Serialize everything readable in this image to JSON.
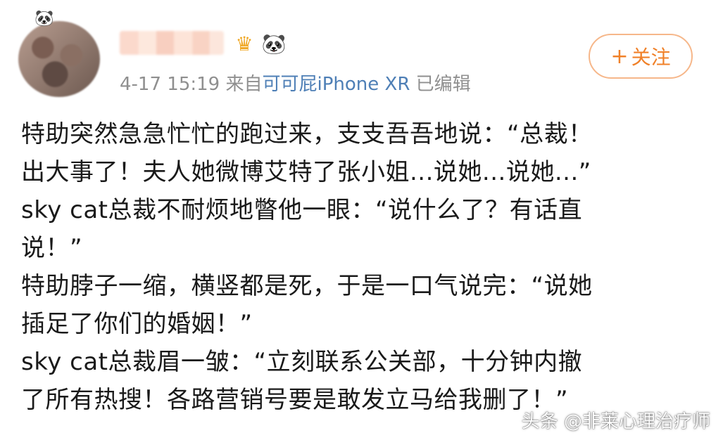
{
  "post": {
    "avatar_badge": "🐼",
    "crown_glyph": "♛",
    "panda_glyph": "🐼",
    "follow_plus": "+",
    "follow_label": "关注",
    "timestamp": "4-17 15:19",
    "source_prefix": "来自",
    "device": "可可屁iPhone XR",
    "edited": "已编辑",
    "lines": [
      "特助突然急急忙忙的跑过来，支支吾吾地说：“总裁！",
      "出大事了！夫人她微博艾特了张小姐...说她...说她...”",
      "sky cat总裁不耐烦地瞥他一眼：“说什么了？有话直",
      "说！”",
      "特助脖子一缩，横竖都是死，于是一口气说完：“说她",
      "插足了你们的婚姻！”",
      "sky cat总裁眉一皱：“立刻联系公关部，十分钟内撤",
      "了所有热搜！各路营销号要是敢发立马给我删了！”"
    ]
  },
  "watermark": "头条 @非莱心理治疗师",
  "colors": {
    "follow_accent": "#f08129",
    "device_link": "#4e7fb6",
    "meta_text": "#8f8f8f"
  }
}
